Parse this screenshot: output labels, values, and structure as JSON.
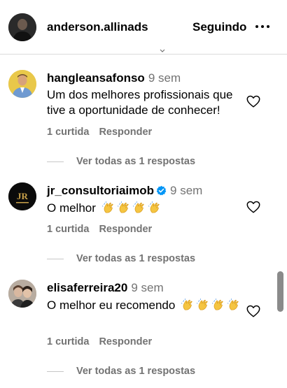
{
  "header": {
    "username": "anderson.allinads",
    "follow_label": "Seguindo"
  },
  "comments": [
    {
      "username": "hangleansafonso",
      "time": "9 sem",
      "text_line1": "Um dos melhores profissionais que",
      "text_line2": "tive a oportunidade de conhecer!",
      "likes": "1 curtida",
      "reply_label": "Responder",
      "view_replies": "Ver todas as 1 respostas",
      "verified": false
    },
    {
      "username": "jr_consultoriaimob",
      "time": "9 sem",
      "text_line1": "O melhor",
      "likes": "1 curtida",
      "reply_label": "Responder",
      "view_replies": "Ver todas as 1 respostas",
      "verified": true,
      "emoji": "clapping-hands",
      "emoji_count": 4
    },
    {
      "username": "elisaferreira20",
      "time": "9 sem",
      "text_line1": "O melhor eu recomendo",
      "likes": "1 curtida",
      "reply_label": "Responder",
      "view_replies": "Ver todas as 1 respostas",
      "verified": false,
      "emoji": "clapping-hands",
      "emoji_count": 4
    }
  ],
  "colors": {
    "text": "#000000",
    "secondary": "#737373",
    "divider": "#dbdbdb",
    "verified": "#0095f6"
  }
}
